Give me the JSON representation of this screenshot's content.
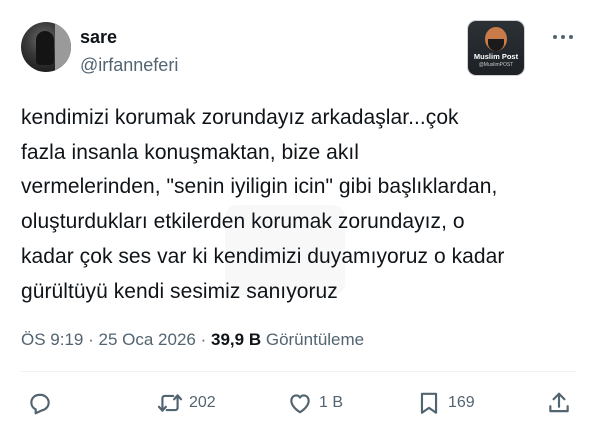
{
  "user": {
    "name": "sare",
    "handle": "@irfanneferi"
  },
  "badge": {
    "title": "Muslim Post",
    "subtitle": "@MuslimPOST"
  },
  "tweet": {
    "text": "kendimizi korumak zorundayız arkadaşlar...çok\nfazla insanla konuşmaktan, bize akıl\nvermelerinden, \"senin iyiligin icin\" gibi başlıklardan,\noluşturdukları etkilerden korumak zorundayız, o\nkadar çok ses var ki kendimizi duyamıyoruz o kadar\ngürültüyü kendi sesimiz sanıyoruz"
  },
  "meta": {
    "time": "ÖS 9:19",
    "separator": "·",
    "date": "25 Oca 2026",
    "views_count": "39,9 B",
    "views_label": "Görüntüleme"
  },
  "actions": {
    "reply": {
      "icon": "reply-icon",
      "count": ""
    },
    "retweet": {
      "icon": "retweet-icon",
      "count": "202"
    },
    "like": {
      "icon": "heart-icon",
      "count": "1 B"
    },
    "bookmark": {
      "icon": "bookmark-icon",
      "count": "169"
    },
    "share": {
      "icon": "share-icon",
      "count": ""
    }
  },
  "colors": {
    "text": "#0f1419",
    "secondary": "#536471",
    "divider": "#eff3f4"
  }
}
